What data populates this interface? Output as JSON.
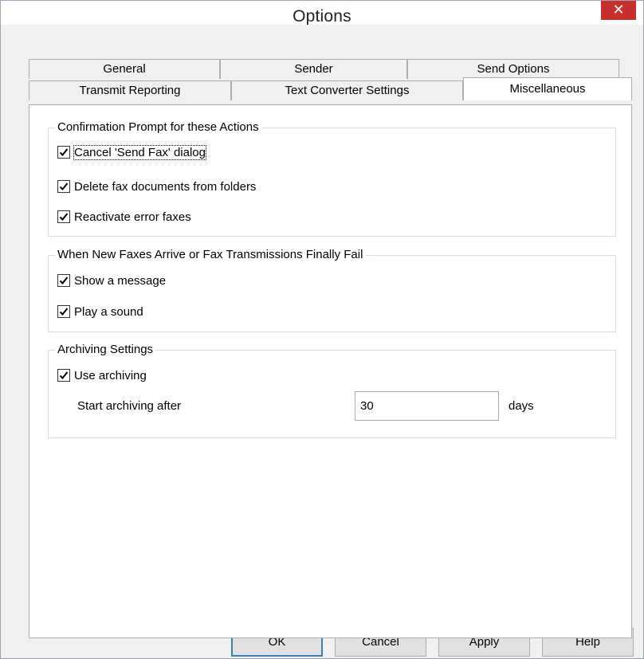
{
  "window": {
    "title": "Options",
    "close_label": "✕"
  },
  "tabs": {
    "row1": [
      {
        "label": "General"
      },
      {
        "label": "Sender"
      },
      {
        "label": "Send Options"
      }
    ],
    "row2": [
      {
        "label": "Transmit Reporting"
      },
      {
        "label": "Text Converter Settings"
      },
      {
        "label": "Miscellaneous",
        "active": true
      }
    ]
  },
  "confirmation": {
    "legend": "Confirmation Prompt for these Actions",
    "items": [
      {
        "label": "Cancel 'Send Fax' dialog",
        "checked": true
      },
      {
        "label": "Delete fax documents from folders",
        "checked": true
      },
      {
        "label": "Reactivate error faxes",
        "checked": true
      }
    ]
  },
  "arrival": {
    "legend": "When New Faxes Arrive or Fax Transmissions Finally Fail",
    "items": [
      {
        "label": "Show a message",
        "checked": true
      },
      {
        "label": "Play a sound",
        "checked": true
      }
    ]
  },
  "archiving": {
    "legend": "Archiving Settings",
    "use_label": "Use archiving",
    "use_checked": true,
    "start_label": "Start archiving after",
    "days_value": "30",
    "days_unit": "days"
  },
  "buttons": {
    "ok": "OK",
    "cancel": "Cancel",
    "apply": "Apply",
    "help": "Help"
  }
}
